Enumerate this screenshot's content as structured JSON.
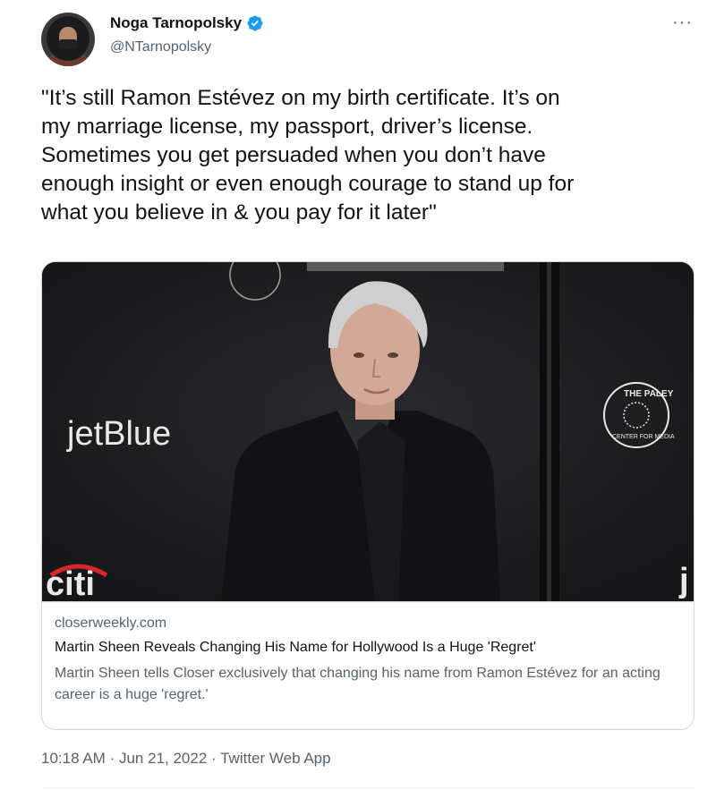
{
  "author": {
    "display_name": "Noga Tarnopolsky",
    "handle": "@NTarnopolsky",
    "verified": true,
    "avatar": "profile-photo"
  },
  "more_icon": "more-horizontal-icon",
  "tweet": {
    "text": "\"It’s still Ramon Estévez on my birth certificate. It’s on\nmy marriage license, my passport, driver’s license.\nSometimes you get persuaded when you don’t have\nenough insight or even enough courage to stand up for\nwhat you believe in & you pay for it later\""
  },
  "card": {
    "domain": "closerweekly.com",
    "title": "Martin Sheen Reveals Changing His Name for Hollywood Is a Huge 'Regret'",
    "description": "Martin Sheen tells Closer exclusively that changing his name from Ramon Estévez for an acting career is a huge 'regret.'",
    "image": {
      "backdrop_logo_left": "jetBlue",
      "backdrop_logo_bottom": "citi",
      "backdrop_logo_right": "j",
      "seal_right_text_top": "THE PALEY",
      "seal_right_text_bottom": "CENTER FOR MEDIA"
    }
  },
  "meta": {
    "time": "10:18 AM",
    "separator": "·",
    "date": "Jun 21, 2022",
    "source": "Twitter Web App"
  },
  "colors": {
    "text": "#0f1419",
    "secondary": "#536471",
    "verified": "#1d9bf0",
    "border": "#cfd9de"
  }
}
